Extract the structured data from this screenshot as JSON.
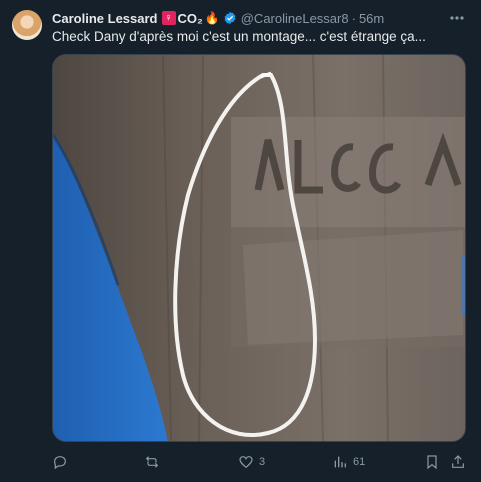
{
  "tweet": {
    "display_name": "Caroline Lessard",
    "name_emoji_1": "♀",
    "name_suffix": "CO₂",
    "name_emoji_2": "🔥",
    "handle": "@CarolineLessar8",
    "separator": "·",
    "time": "56m",
    "text": "Check Dany d'après moi c'est un montage... c'est étrange ça...",
    "media_alt": "Photo",
    "actions": {
      "reply_count": "",
      "retweet_count": "",
      "like_count": "3",
      "views_count": "61"
    }
  },
  "icons": {
    "verified": "verified-badge-icon",
    "more": "more-options-icon",
    "reply": "reply-icon",
    "retweet": "retweet-icon",
    "like": "heart-icon",
    "views": "views-icon",
    "bookmark": "bookmark-icon",
    "share": "share-icon"
  },
  "colors": {
    "background": "#15202b",
    "text": "#e7e9ea",
    "muted": "#8b98a5",
    "verified": "#1d9bf0",
    "badge_pink": "#e0245e"
  }
}
